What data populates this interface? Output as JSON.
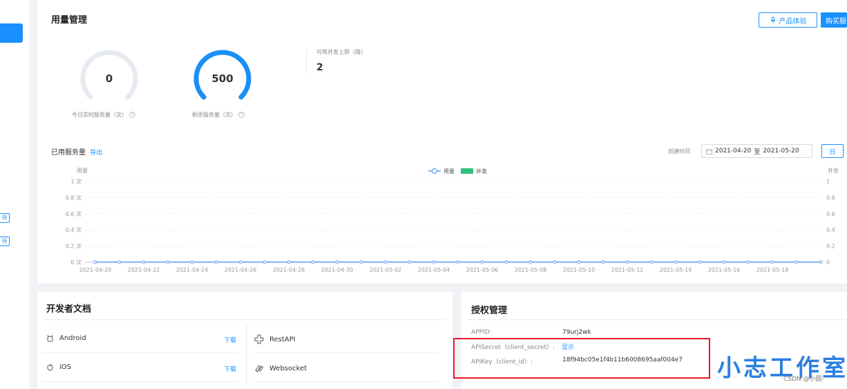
{
  "usage": {
    "title": "用量管理",
    "btn_experience": "产品体验",
    "btn_buy": "购买服务",
    "gauge_today": {
      "value": "0",
      "label": "今日实时服务量（次）",
      "fill": 0
    },
    "gauge_remaining": {
      "value": "500",
      "label": "剩余服务量（次）",
      "fill": 1
    },
    "concurrency_label": "可用并发上限（路）",
    "concurrency_value": "2"
  },
  "chart_section": {
    "title": "已用服务量",
    "export": "导出",
    "created_time_label": "创建时间",
    "date_start": "2021-04-20",
    "date_sep": "至",
    "date_end": "2021-05-20",
    "day_btn": "日"
  },
  "chart_data": {
    "type": "line",
    "ylabel_left": "用量",
    "ylabel_right": "并发",
    "legend": [
      {
        "name": "用量",
        "color": "#5b9ff2",
        "style": "line-marker"
      },
      {
        "name": "并发",
        "color": "#2ec27e",
        "style": "bar"
      }
    ],
    "legend_position": "top-center",
    "y_ticks_left": [
      "1 次",
      "0.8 次",
      "0.6 次",
      "0.4 次",
      "0.2 次",
      "0 次"
    ],
    "y_ticks_right": [
      "1",
      "0.8",
      "0.6",
      "0.4",
      "0.2",
      "0"
    ],
    "ylim": [
      0,
      1
    ],
    "x_tick_labels": [
      "2021-04-20",
      "2021-04-22",
      "2021-04-24",
      "2021-04-26",
      "2021-04-28",
      "2021-04-30",
      "2021-05-02",
      "2021-05-04",
      "2021-05-06",
      "2021-05-08",
      "2021-05-10",
      "2021-05-12",
      "2021-05-14",
      "2021-05-16",
      "2021-05-18"
    ],
    "series": [
      {
        "name": "用量",
        "values": [
          0,
          0,
          0,
          0,
          0,
          0,
          0,
          0,
          0,
          0,
          0,
          0,
          0,
          0,
          0,
          0,
          0,
          0,
          0,
          0,
          0,
          0,
          0,
          0,
          0,
          0,
          0,
          0,
          0,
          0,
          0
        ]
      }
    ],
    "grid": true
  },
  "docs": {
    "title": "开发者文档",
    "items": [
      {
        "name": "Android",
        "download": "下载",
        "icon": "android-icon"
      },
      {
        "name": "iOS",
        "download": "下载",
        "icon": "apple-icon"
      }
    ],
    "apis": [
      {
        "name": "RestAPI",
        "icon": "restapi-icon"
      },
      {
        "name": "Websocket",
        "icon": "websocket-icon"
      }
    ]
  },
  "auth": {
    "title": "授权管理",
    "appid_label": "APPID:",
    "appid_value": "79urj2wk",
    "secret_label": "APISecret（client_secret）:",
    "secret_action": "显示",
    "key_label": "APIKey（client_id）:",
    "key_value": "18f94bc05e1f4b11b6008695aaf004e7"
  },
  "sidebar": {
    "tag1": "待",
    "tag2": "待"
  },
  "watermark": "小志工作室",
  "csdn": "CSDN @小圆-",
  "colors": {
    "accent": "#1890ff",
    "highlight": "#e8162c"
  }
}
